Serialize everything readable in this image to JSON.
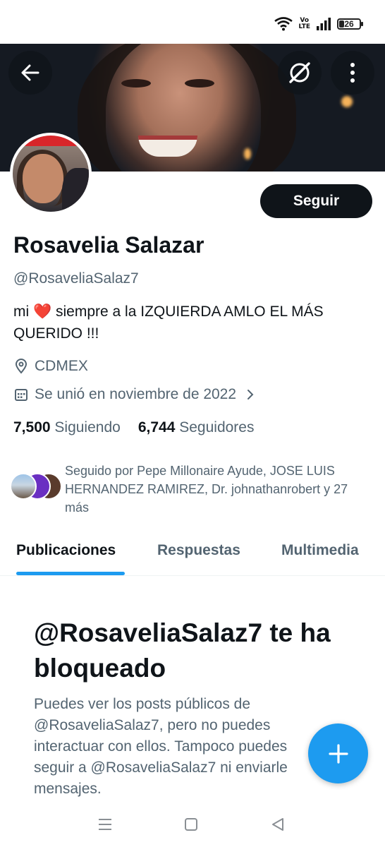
{
  "status_bar": {
    "volte_line1": "Vo",
    "volte_line2": "LTE",
    "battery_level": "26"
  },
  "profile": {
    "display_name": "Rosavelia Salazar",
    "handle": "@RosaveliaSalaz7",
    "bio_before": "mi",
    "bio_emoji": "❤️",
    "bio_after": "siempre a la IZQUIERDA AMLO EL MÁS QUERIDO !!!",
    "location": "CDMEX",
    "joined": "Se unió en noviembre de 2022",
    "following_count": "7,500",
    "following_label": "Siguiendo",
    "followers_count": "6,744",
    "followers_label": "Seguidores",
    "followed_by": "Seguido por Pepe Millonaire Ayude, JOSE LUIS HERNANDEZ RAMIREZ, Dr. johnathanrobert y 27 más"
  },
  "actions": {
    "follow_label": "Seguir"
  },
  "tabs": [
    {
      "label": "Publicaciones",
      "active": true
    },
    {
      "label": "Respuestas",
      "active": false
    },
    {
      "label": "Multimedia",
      "active": false
    }
  ],
  "blocked": {
    "title": "@RosaveliaSalaz7 te ha bloqueado",
    "message": "Puedes ver los posts públicos de @RosaveliaSalaz7, pero no puedes interactuar con ellos. Tampoco puedes seguir a @RosaveliaSalaz7 ni enviarle mensajes."
  },
  "colors": {
    "accent": "#1d9bf0",
    "text_primary": "#0f1419",
    "text_secondary": "#536471",
    "follow_button_bg": "#0f1419"
  },
  "icons": {
    "back": "arrow-left-icon",
    "grok": "slash-circle-icon",
    "more": "vertical-ellipsis-icon",
    "location": "map-pin-icon",
    "calendar": "calendar-icon",
    "compose": "plus-icon"
  }
}
